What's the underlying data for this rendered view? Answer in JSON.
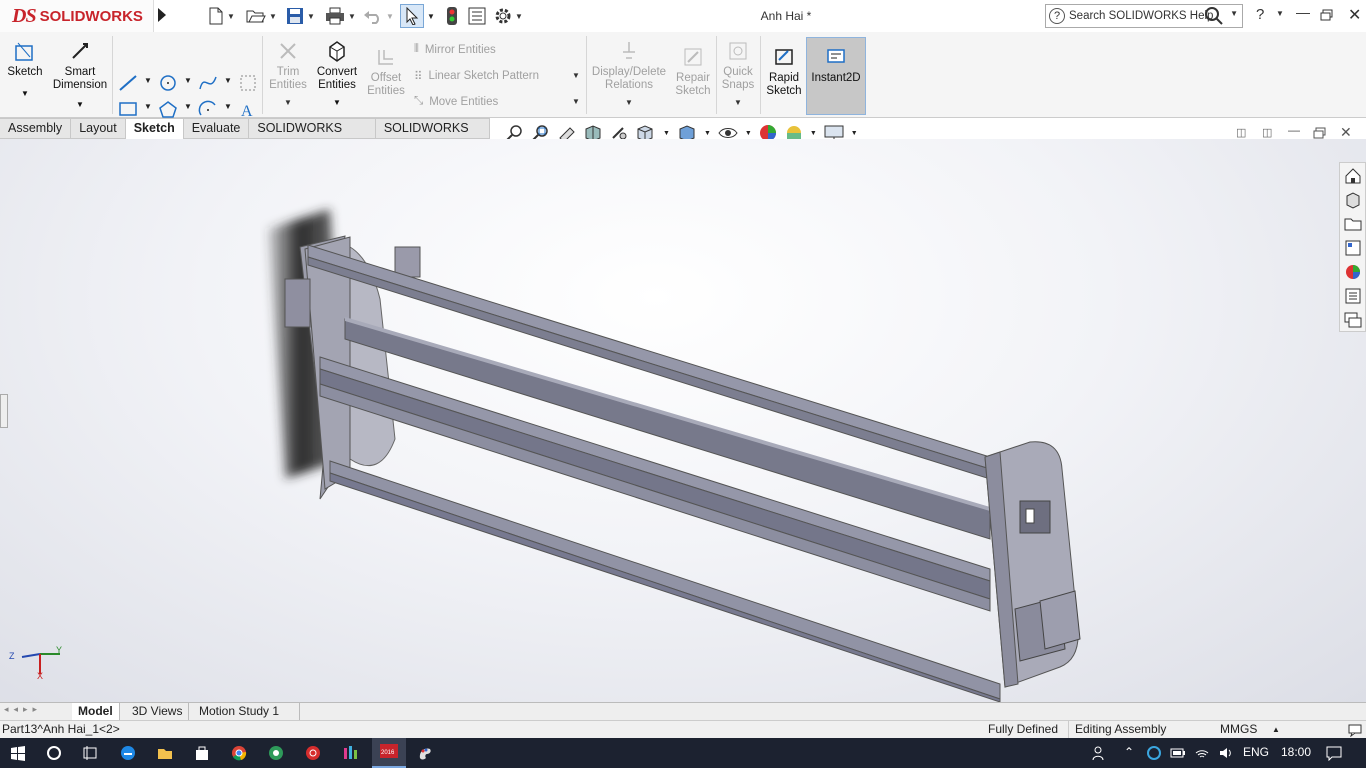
{
  "app": {
    "brand_ds": "DS",
    "brand_name": "SOLIDWORKS",
    "document_title": "Anh Hai *"
  },
  "search": {
    "placeholder": "Search SOLIDWORKS Help"
  },
  "ribbon": {
    "sketch": "Sketch",
    "smart_dimension_1": "Smart",
    "smart_dimension_2": "Dimension",
    "trim_1": "Trim",
    "trim_2": "Entities",
    "convert_1": "Convert",
    "convert_2": "Entities",
    "offset_1": "Offset",
    "offset_2": "Entities",
    "mirror": "Mirror Entities",
    "linear_pattern": "Linear Sketch Pattern",
    "move": "Move Entities",
    "display_delete_1": "Display/Delete",
    "display_delete_2": "Relations",
    "repair_1": "Repair",
    "repair_2": "Sketch",
    "quick_1": "Quick",
    "quick_2": "Snaps",
    "rapid_1": "Rapid",
    "rapid_2": "Sketch",
    "instant2d": "Instant2D"
  },
  "tabs": [
    "Assembly",
    "Layout",
    "Sketch",
    "Evaluate",
    "SOLIDWORKS Add-Ins",
    "SOLIDWORKS MBD"
  ],
  "active_tab": "Sketch",
  "triad": {
    "x": "X",
    "y": "Y",
    "z": "Z"
  },
  "bottom_tabs": {
    "model": "Model",
    "views3d": "3D Views",
    "motion": "Motion Study 1"
  },
  "status": {
    "component": "Part13^Anh Hai_1<2>",
    "state": "Fully Defined",
    "mode": "Editing Assembly",
    "units": "MMGS"
  },
  "taskbar": {
    "lang": "ENG",
    "time": "18:00",
    "badge": "2016"
  },
  "colors": {
    "accent": "#c8242b",
    "model": "#8c8d9e",
    "taskbar": "#1c2230"
  }
}
